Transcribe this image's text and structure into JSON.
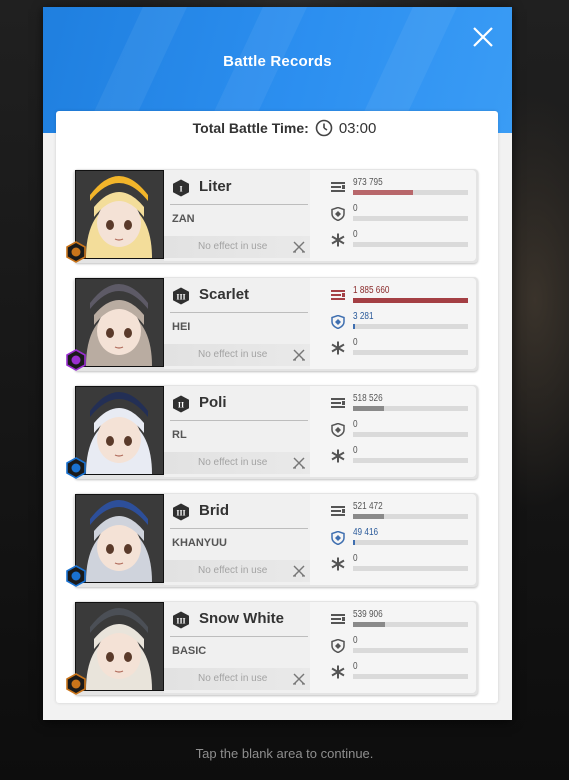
{
  "dialog": {
    "title": "Battle Records",
    "total_time_label": "Total Battle Time:",
    "total_time_value": "03:00",
    "effect_text": "No effect in use"
  },
  "characters": [
    {
      "name": "Liter",
      "weapon": "ZAN",
      "rank": "I",
      "burst": "burst-hexagon",
      "damage": "973 795",
      "damage_ratio": 0.52,
      "shield": "0",
      "shield_ratio": 0,
      "heal": "0",
      "heal_ratio": 0,
      "hair": "#f3dd9a",
      "hat": "#f2b52a",
      "element_color": "#c9741a"
    },
    {
      "name": "Scarlet",
      "weapon": "HEI",
      "rank": "III",
      "burst": "burst-lightning",
      "damage": "1 885 660",
      "damage_ratio": 1.0,
      "shield": "3 281",
      "shield_ratio": 0.0,
      "heal": "0",
      "heal_ratio": 0,
      "hair": "#b9aca1",
      "hat": "#5d5a66",
      "element_color": "#9a2fd1"
    },
    {
      "name": "Poli",
      "weapon": "RL",
      "rank": "II",
      "burst": "burst-water",
      "damage": "518 526",
      "damage_ratio": 0.27,
      "shield": "0",
      "shield_ratio": 0,
      "heal": "0",
      "heal_ratio": 0,
      "hair": "#e8ebf3",
      "hat": "#232f55",
      "element_color": "#1a72d1"
    },
    {
      "name": "Brid",
      "weapon": "KHANYUU",
      "rank": "III",
      "burst": "burst-water",
      "damage": "521 472",
      "damage_ratio": 0.27,
      "shield": "49 416",
      "shield_ratio": 0.02,
      "heal": "0",
      "heal_ratio": 0,
      "hair": "#cfd3dc",
      "hat": "#2d4f9a",
      "element_color": "#1a72d1"
    },
    {
      "name": "Snow White",
      "weapon": "BASIC",
      "rank": "III",
      "burst": "burst-hexagon",
      "damage": "539 906",
      "damage_ratio": 0.28,
      "shield": "0",
      "shield_ratio": 0,
      "heal": "0",
      "heal_ratio": 0,
      "hair": "#e9e4db",
      "hat": "#4b4f56",
      "element_color": "#c9741a"
    }
  ],
  "colors": {
    "header_blue": "#2c8ff0",
    "damage_bar": "#a43f44",
    "shield_bar": "#3f6fb0",
    "neutral_bar": "#8a8a8a"
  },
  "footer": {
    "hint": "Tap the blank area to continue."
  }
}
